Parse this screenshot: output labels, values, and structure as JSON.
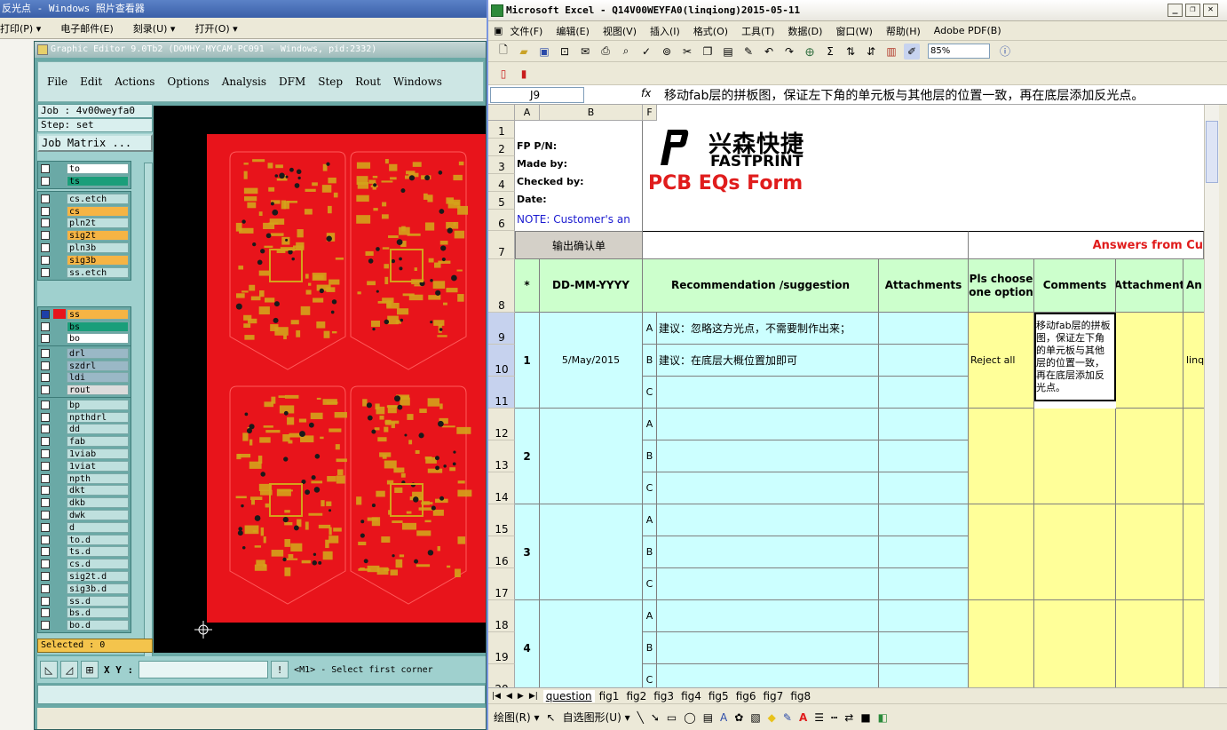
{
  "photo_viewer": {
    "title": "反光点 - Windows 照片查看器",
    "menu": [
      "打印(P) ▾",
      "电子邮件(E)",
      "刻录(U) ▾",
      "打开(O) ▾"
    ]
  },
  "genesis": {
    "title": "Graphic Editor 9.0Tb2 (DOMHY-MYCAM-PC091 - Windows, pid:2332)",
    "menu": [
      "File",
      "Edit",
      "Actions",
      "Options",
      "Analysis",
      "DFM",
      "Step",
      "Rout",
      "Windows"
    ],
    "job": "Job : 4v00weyfa0",
    "step": "Step: set",
    "job_matrix": "Job Matrix ...",
    "layer_groups": [
      [
        {
          "name": "to",
          "color": "#ffffff"
        },
        {
          "name": "ts",
          "color": "#1a9e7a"
        }
      ],
      [
        {
          "name": "cs.etch",
          "color": "#bfe0de"
        },
        {
          "name": "cs",
          "color": "#f6b444"
        },
        {
          "name": "pln2t",
          "color": "#bfe0de"
        },
        {
          "name": "sig2t",
          "color": "#f6b444"
        },
        {
          "name": "pln3b",
          "color": "#bfe0de"
        },
        {
          "name": "sig3b",
          "color": "#f6b444"
        },
        {
          "name": "ss.etch",
          "color": "#bfe0de"
        }
      ],
      [
        {
          "name": "ss",
          "color": "#f6b444",
          "on": true
        },
        {
          "name": "bs",
          "color": "#1a9e7a"
        },
        {
          "name": "bo",
          "color": "#ffffff"
        }
      ],
      [
        {
          "name": "drl",
          "color": "#9ab8c6"
        },
        {
          "name": "szdrl",
          "color": "#9ab8c6"
        },
        {
          "name": "ldi",
          "color": "#9ab8c6"
        },
        {
          "name": "rout",
          "color": "#dcdcdc"
        }
      ],
      [
        {
          "name": "bp",
          "color": "#bfe0de"
        },
        {
          "name": "npthdrl",
          "color": "#bfe0de"
        },
        {
          "name": "dd",
          "color": "#bfe0de"
        },
        {
          "name": "fab",
          "color": "#bfe0de"
        },
        {
          "name": "1viab",
          "color": "#bfe0de"
        },
        {
          "name": "1viat",
          "color": "#bfe0de"
        },
        {
          "name": "npth",
          "color": "#bfe0de"
        },
        {
          "name": "dkt",
          "color": "#bfe0de"
        },
        {
          "name": "dkb",
          "color": "#bfe0de"
        },
        {
          "name": "dwk",
          "color": "#bfe0de"
        },
        {
          "name": "d",
          "color": "#bfe0de"
        },
        {
          "name": "to.d",
          "color": "#bfe0de"
        },
        {
          "name": "ts.d",
          "color": "#bfe0de"
        },
        {
          "name": "cs.d",
          "color": "#bfe0de"
        },
        {
          "name": "sig2t.d",
          "color": "#bfe0de"
        },
        {
          "name": "sig3b.d",
          "color": "#bfe0de"
        },
        {
          "name": "ss.d",
          "color": "#bfe0de"
        },
        {
          "name": "bs.d",
          "color": "#bfe0de"
        },
        {
          "name": "bo.d",
          "color": "#bfe0de"
        }
      ]
    ],
    "selected": "Selected : 0",
    "xy_label": "X Y :",
    "prompt": "<M1> - Select first corner",
    "colors": {
      "board": "#e8141b",
      "copper": "#d4a21b",
      "bg": "#000000"
    }
  },
  "excel": {
    "title": "Microsoft Excel - Q14V00WEYFA0(linqiong)2015-05-11",
    "menu": [
      "文件(F)",
      "编辑(E)",
      "视图(V)",
      "插入(I)",
      "格式(O)",
      "工具(T)",
      "数据(D)",
      "窗口(W)",
      "帮助(H)",
      "Adobe PDF(B)"
    ],
    "zoom": "85%",
    "name_box": "J9",
    "fx": "fx",
    "formula": "移动fab层的拼板图，保证左下角的单元板与其他层的位置一致，再在底层添加反光点。",
    "columns": [
      "A",
      "B",
      "F"
    ],
    "rows": [
      "1",
      "2",
      "3",
      "4",
      "5",
      "6",
      "7",
      "8",
      "9",
      "10",
      "11",
      "12",
      "13",
      "14",
      "15",
      "16",
      "17",
      "18",
      "19",
      "20"
    ],
    "header_labels": [
      "FP P/N:",
      "Made by:",
      "Checked by:",
      "Date:"
    ],
    "note": "NOTE: Customer's  an",
    "logo_cn": "兴森快捷",
    "logo_en": "FASTPRINT",
    "form_title": "PCB EQs Form",
    "export_button": "输出确认单",
    "answers_heading": "Answers from Cu",
    "table_headers": {
      "star": "*",
      "date": "DD-MM-YYYY",
      "rec": "Recommendation /suggestion",
      "att": "Attachments",
      "pls": "Pls choose one option",
      "comments": "Comments",
      "attachment": "Attachment",
      "an": "An"
    },
    "items": [
      {
        "no": "1",
        "date": "5/May/2015",
        "a": "建议：忽略这方光点，不需要制作出来；",
        "b": "建议：在底层大概位置加即可",
        "c": "",
        "option": "Reject all",
        "comment": "移动fab层的拼板图，保证左下角的单元板与其他层的位置一致，再在底层添加反光点。",
        "an": "linq"
      },
      {
        "no": "2",
        "date": "",
        "a": "",
        "b": "",
        "c": "",
        "option": "",
        "comment": "",
        "an": ""
      },
      {
        "no": "3",
        "date": "",
        "a": "",
        "b": "",
        "c": "",
        "option": "",
        "comment": "",
        "an": ""
      },
      {
        "no": "4",
        "date": "",
        "a": "",
        "b": "",
        "c": "",
        "option": "",
        "comment": "",
        "an": ""
      }
    ],
    "sub_labels": [
      "A",
      "B",
      "C"
    ],
    "sheets": [
      "question",
      "fig1",
      "fig2",
      "fig3",
      "fig4",
      "fig5",
      "fig6",
      "fig7",
      "fig8"
    ],
    "draw_label": "绘图(R) ▾",
    "autoshape_label": "自选图形(U) ▾"
  }
}
